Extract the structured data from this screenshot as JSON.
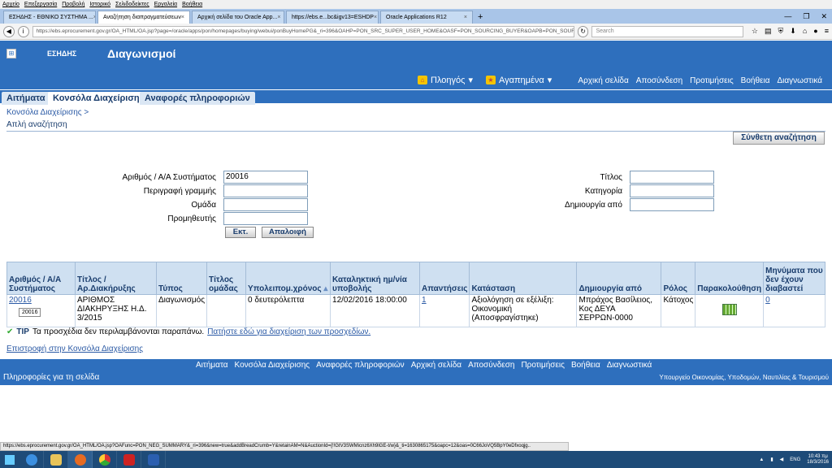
{
  "browser_menu": [
    "Αρχείο",
    "Επεξεργασία",
    "Προβολή",
    "Ιστορικό",
    "Σελιδοδείκτες",
    "Εργαλεία",
    "Βοήθεια"
  ],
  "browser_tabs": [
    {
      "label": "ΕΣΗΔΗΣ - ΕΘΝΙΚΟ ΣΥΣΤΗΜΑ ..."
    },
    {
      "label": "Αναζήτηση διαπραγματεύσεων"
    },
    {
      "label": "Αρχική σελίδα του Oracle App..."
    },
    {
      "label": "https://ebs.e...bc&igv13=ESHDP"
    },
    {
      "label": "Oracle Applications R12"
    }
  ],
  "url": "https://ebs.eprocurement.gov.gr/OA_HTML/OA.jsp?page=/oracle/apps/pon/homepages/buying/webui/ponBuyHomePG&_ri=396&OAHP=PON_SRC_SUPER_USER_HOME&OASF=PON_SOURCING_BUYER&OAPB=PON_SOUR",
  "search_placeholder": "Search",
  "header": {
    "brand": "ΕΣΗΔΗΣ",
    "title": "Διαγωνισμοί"
  },
  "global_nav": {
    "navigator": "Πλοηγός",
    "favorites": "Αγαπημένα",
    "links": [
      "Αρχική σελίδα",
      "Αποσύνδεση",
      "Προτιμήσεις",
      "Βοήθεια",
      "Διαγνωστικά"
    ]
  },
  "app_tabs": [
    "Αιτήματα",
    "Κονσόλα Διαχείρισης",
    "Αναφορές πληροφοριών"
  ],
  "breadcrumb": "Κονσόλα Διαχείρισης  >",
  "page_title": "Απλή αναζήτηση",
  "advanced_search": "Σύνθετη αναζήτηση",
  "form": {
    "number_label": "Αριθμός / Α/Α Συστήματος",
    "number_value": "20016",
    "line_desc_label": "Περιγραφή γραμμής",
    "group_label": "Ομάδα",
    "supplier_label": "Προμηθευτής",
    "title_label": "Τίτλος",
    "category_label": "Κατηγορία",
    "created_by_label": "Δημιουργία από",
    "go_button": "Εκτ.",
    "clear_button": "Απαλοιφή"
  },
  "table": {
    "headers": [
      "Αριθμός / Α/Α Συστήματος",
      "Τίτλος / Αρ.Διακήρυξης",
      "Τύπος",
      "Τίτλος ομάδας",
      "Υπολειπομ.χρόνος",
      "Καταληκτική ημ/νία υποβολής",
      "Απαντήσεις",
      "Κατάσταση",
      "Δημιουργία από",
      "Ρόλος",
      "Παρακολούθηση",
      "Μηνύματα που δεν έχουν διαβαστεί"
    ],
    "rows": [
      {
        "number": "20016",
        "sub": "20016",
        "title": "ΑΡΙΘΜΟΣ ΔΙΑΚΗΡΥΞΗΣ Η.Δ. 3/2015",
        "type": "Διαγωνισμός",
        "group": "",
        "remaining": "0 δευτερόλεπτα",
        "deadline": "12/02/2016 18:00:00",
        "responses": "1",
        "status": "Αξιολόγηση σε εξέλιξη: Οικονομική (Αποσφραγίστηκε)",
        "created_by": "Μπράχος Βασίλειος, Κος ΔΕΥΑ ΣΕΡΡΩΝ-0000",
        "role": "Κάτοχος",
        "unread": "0"
      }
    ]
  },
  "tip": {
    "label": "TIP",
    "text": "Τα προσχέδια δεν περιλαμβάνονται παραπάνω.",
    "link": "Πατήστε εδώ για διαχείριση των προσχεδίων."
  },
  "return_link": "Επιστροφή στην Κονσόλα Διαχείρισης",
  "footer": {
    "links": [
      "Αιτήματα",
      "Κονσόλα Διαχείρισης",
      "Αναφορές πληροφοριών",
      "Αρχική σελίδα",
      "Αποσύνδεση",
      "Προτιμήσεις",
      "Βοήθεια",
      "Διαγνωστικά"
    ],
    "info": "Πληροφορίες για τη σελίδα",
    "ministry": "Υπουργείο Οικονομίας, Υποδομών, Ναυτιλίας & Τουρισμού"
  },
  "status_url": "https://ebs.eprocurement.gov.gr/OA_HTML/OA.jsp?OAFunc=PON_NEG_SUMMARY&_ri=396&new=true&addBreadCrumb=Y&retainAM=N&AuctionId={!!GtV3SWMicnz6Xh9lGE-t/w}&_ti=1630865175&oapc=12&oas=0C66JoVQ5BpY0eDfxoqjg..",
  "taskbar": {
    "lang": "ENG",
    "time": "10:43 πμ",
    "date": "18/3/2016"
  }
}
